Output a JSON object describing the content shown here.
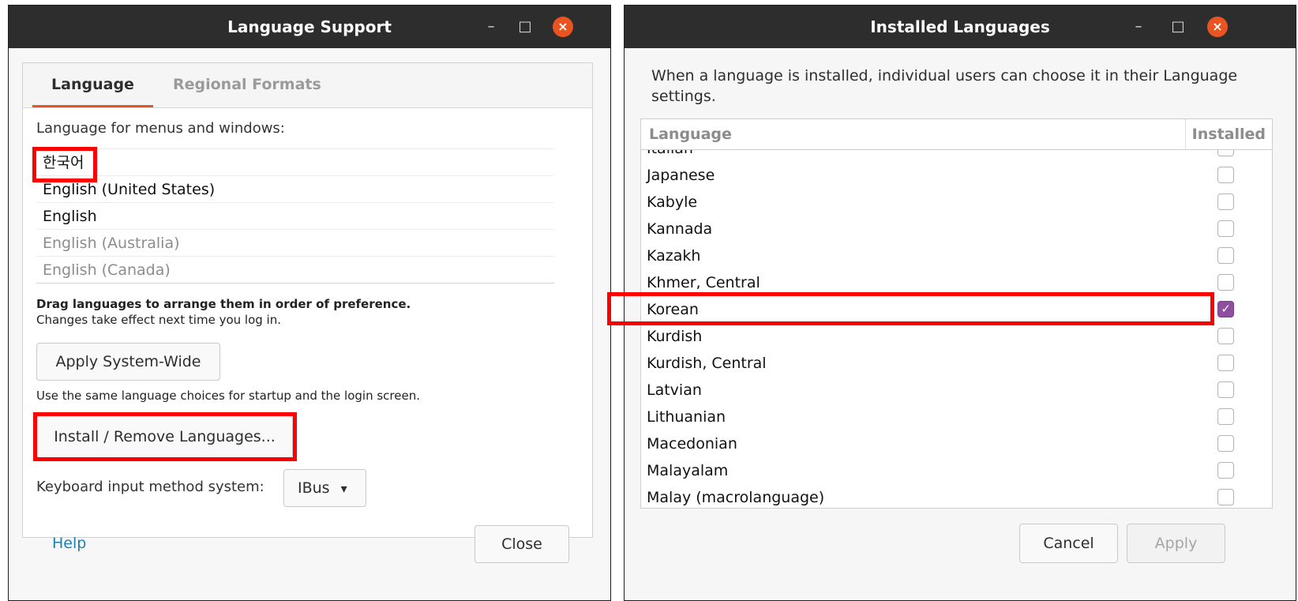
{
  "left_window": {
    "title": "Language Support",
    "controls": {
      "minimize": "–",
      "maximize": "□",
      "close": "×"
    },
    "tabs": [
      "Language",
      "Regional Formats"
    ],
    "section_label": "Language for menus and windows:",
    "languages": [
      "한국어",
      "English (United States)",
      "English",
      "English (Australia)",
      "English (Canada)"
    ],
    "drag_hint_bold": "Drag languages to arrange them in order of preference.",
    "drag_hint": "Changes take effect next time you log in.",
    "apply_system_wide": "Apply System-Wide",
    "apply_hint": "Use the same language choices for startup and the login screen.",
    "install_remove": "Install / Remove Languages...",
    "keyboard_label": "Keyboard input method system:",
    "keyboard_value": "IBus",
    "dropdown_arrow": "▾",
    "help": "Help",
    "close": "Close"
  },
  "right_window": {
    "title": "Installed Languages",
    "controls": {
      "minimize": "–",
      "maximize": "□",
      "close": "×"
    },
    "description": "When a language is installed, individual users can choose it in their Language settings.",
    "columns": {
      "language": "Language",
      "installed": "Installed"
    },
    "rows": [
      {
        "name": "Italian",
        "installed": false
      },
      {
        "name": "Japanese",
        "installed": false
      },
      {
        "name": "Kabyle",
        "installed": false
      },
      {
        "name": "Kannada",
        "installed": false
      },
      {
        "name": "Kazakh",
        "installed": false
      },
      {
        "name": "Khmer, Central",
        "installed": false
      },
      {
        "name": "Korean",
        "installed": true
      },
      {
        "name": "Kurdish",
        "installed": false
      },
      {
        "name": "Kurdish, Central",
        "installed": false
      },
      {
        "name": "Latvian",
        "installed": false
      },
      {
        "name": "Lithuanian",
        "installed": false
      },
      {
        "name": "Macedonian",
        "installed": false
      },
      {
        "name": "Malayalam",
        "installed": false
      },
      {
        "name": "Malay (macrolanguage)",
        "installed": false
      }
    ],
    "cancel": "Cancel",
    "apply": "Apply"
  },
  "colors": {
    "accent": "#e95420",
    "highlight_red": "#ff0000",
    "checkbox_checked": "#8e4fa0",
    "link": "#1e7fb5"
  }
}
